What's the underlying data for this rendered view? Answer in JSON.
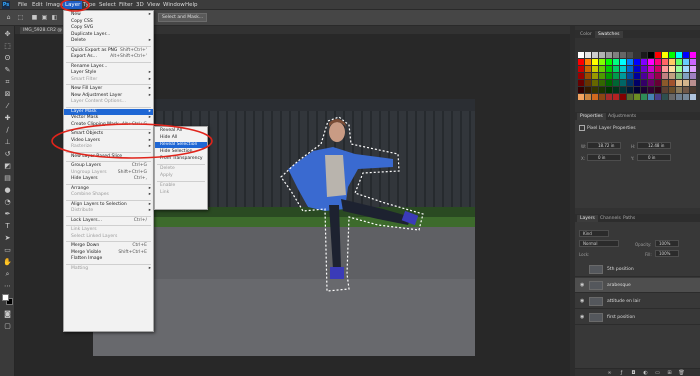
{
  "menubar": {
    "logo": "Ps",
    "items": [
      "File",
      "Edit",
      "Image",
      "Layer",
      "Type",
      "Select",
      "Filter",
      "3D",
      "View",
      "Window",
      "Help"
    ],
    "active": "Layer"
  },
  "options": {
    "select_and_mask": "Select and Mask..."
  },
  "document": {
    "tab_title": "IMG_5928.CR2 @ 16..."
  },
  "layer_menu": {
    "items": [
      {
        "label": "New",
        "arrow": "▸"
      },
      {
        "label": "Copy CSS"
      },
      {
        "label": "Copy SVG"
      },
      {
        "label": "Duplicate Layer..."
      },
      {
        "label": "Delete",
        "arrow": "▸"
      },
      {
        "sep": true
      },
      {
        "label": "Quick Export as PNG",
        "shortcut": "Shift+Ctrl+'"
      },
      {
        "label": "Export As...",
        "shortcut": "Alt+Shift+Ctrl+'"
      },
      {
        "sep": true
      },
      {
        "label": "Rename Layer..."
      },
      {
        "label": "Layer Style",
        "arrow": "▸"
      },
      {
        "label": "Smart Filter",
        "arrow": "▸",
        "disabled": true
      },
      {
        "sep": true
      },
      {
        "label": "New Fill Layer",
        "arrow": "▸"
      },
      {
        "label": "New Adjustment Layer",
        "arrow": "▸"
      },
      {
        "label": "Layer Content Options...",
        "disabled": true
      },
      {
        "sep": true
      },
      {
        "label": "Layer Mask",
        "arrow": "▸",
        "highlighted": true
      },
      {
        "label": "Vector Mask",
        "arrow": "▸"
      },
      {
        "label": "Create Clipping Mask",
        "shortcut": "Alt+Ctrl+G"
      },
      {
        "sep": true
      },
      {
        "label": "Smart Objects",
        "arrow": "▸"
      },
      {
        "label": "Video Layers",
        "arrow": "▸"
      },
      {
        "label": "Rasterize",
        "arrow": "▸",
        "disabled": true
      },
      {
        "sep": true
      },
      {
        "label": "New Layer Based Slice"
      },
      {
        "sep": true
      },
      {
        "label": "Group Layers",
        "shortcut": "Ctrl+G"
      },
      {
        "label": "Ungroup Layers",
        "shortcut": "Shift+Ctrl+G",
        "disabled": true
      },
      {
        "label": "Hide Layers",
        "shortcut": "Ctrl+,"
      },
      {
        "sep": true
      },
      {
        "label": "Arrange",
        "arrow": "▸"
      },
      {
        "label": "Combine Shapes",
        "arrow": "▸",
        "disabled": true
      },
      {
        "sep": true
      },
      {
        "label": "Align Layers to Selection",
        "arrow": "▸"
      },
      {
        "label": "Distribute",
        "arrow": "▸",
        "disabled": true
      },
      {
        "sep": true
      },
      {
        "label": "Lock Layers...",
        "shortcut": "Ctrl+/"
      },
      {
        "sep": true
      },
      {
        "label": "Link Layers",
        "disabled": true
      },
      {
        "label": "Select Linked Layers",
        "disabled": true
      },
      {
        "sep": true
      },
      {
        "label": "Merge Down",
        "shortcut": "Ctrl+E"
      },
      {
        "label": "Merge Visible",
        "shortcut": "Shift+Ctrl+E"
      },
      {
        "label": "Flatten Image"
      },
      {
        "sep": true
      },
      {
        "label": "Matting",
        "arrow": "▸",
        "disabled": true
      }
    ]
  },
  "layer_mask_submenu": {
    "items": [
      {
        "label": "Reveal All"
      },
      {
        "label": "Hide All"
      },
      {
        "label": "Reveal Selection",
        "highlighted": true
      },
      {
        "label": "Hide Selection"
      },
      {
        "label": "From Transparency"
      },
      {
        "sep": true
      },
      {
        "label": "Delete",
        "disabled": true
      },
      {
        "label": "Apply",
        "disabled": true
      },
      {
        "sep": true
      },
      {
        "label": "Enable",
        "disabled": true
      },
      {
        "label": "Link",
        "disabled": true
      }
    ]
  },
  "panels": {
    "color_tabs": [
      "Color",
      "Swatches"
    ],
    "properties_tabs": [
      "Properties",
      "Adjustments"
    ],
    "properties_title": "Pixel Layer Properties",
    "prop_w_label": "W:",
    "prop_w": "18.72 in",
    "prop_h_label": "H:",
    "prop_h": "12.48 in",
    "prop_x_label": "X:",
    "prop_x": "0 in",
    "prop_y_label": "Y:",
    "prop_y": "0 in",
    "layers_tabs": [
      "Layers",
      "Channels",
      "Paths"
    ],
    "kind_filter": "Kind",
    "blend_mode": "Normal",
    "opacity_label": "Opacity:",
    "opacity": "100%",
    "lock_label": "Lock:",
    "fill_label": "Fill:",
    "fill": "100%",
    "layers": [
      {
        "name": "5th position",
        "visible": false,
        "selected": false
      },
      {
        "name": "arabesque",
        "visible": true,
        "selected": true
      },
      {
        "name": "attitude en lair",
        "visible": true,
        "selected": false
      },
      {
        "name": "first position",
        "visible": true,
        "selected": false
      }
    ]
  },
  "swatch_colors": [
    [
      "#ffffff",
      "#e6e6e6",
      "#cccccc",
      "#b3b3b3",
      "#999999",
      "#808080",
      "#666666",
      "#4d4d4d",
      "#333333",
      "#1a1a1a",
      "#000000",
      "#ff0000",
      "#ffff00",
      "#00ff00",
      "#00ffff",
      "#0000ff",
      "#ff00ff"
    ],
    [
      "#ff0000",
      "#ff8000",
      "#ffff00",
      "#80ff00",
      "#00ff00",
      "#00ff80",
      "#00ffff",
      "#0080ff",
      "#0000ff",
      "#8000ff",
      "#ff00ff",
      "#ff0080",
      "#ff6666",
      "#ffcc66",
      "#66ff66",
      "#66ccff",
      "#cc66ff"
    ],
    [
      "#cc0000",
      "#cc6600",
      "#cccc00",
      "#66cc00",
      "#00cc00",
      "#00cc66",
      "#00cccc",
      "#0066cc",
      "#0000cc",
      "#6600cc",
      "#cc00cc",
      "#cc0066",
      "#ff9999",
      "#ffe0a0",
      "#99ff99",
      "#a0d8ff",
      "#e0a0ff"
    ],
    [
      "#990000",
      "#994c00",
      "#999900",
      "#4c9900",
      "#009900",
      "#00994c",
      "#009999",
      "#004c99",
      "#000099",
      "#4c0099",
      "#990099",
      "#99004c",
      "#c08080",
      "#c0a080",
      "#80c080",
      "#80a0c0",
      "#a080c0"
    ],
    [
      "#660000",
      "#663300",
      "#666600",
      "#336600",
      "#006600",
      "#006633",
      "#006666",
      "#003366",
      "#000066",
      "#330066",
      "#660066",
      "#660033",
      "#8b5a2b",
      "#a0522d",
      "#deb887",
      "#d2b48c",
      "#bc8f8f"
    ],
    [
      "#330000",
      "#331a00",
      "#333300",
      "#1a3300",
      "#003300",
      "#00331a",
      "#003333",
      "#001a33",
      "#000033",
      "#1a0033",
      "#330033",
      "#33001a",
      "#5c4033",
      "#6b4f2a",
      "#8a7a5a",
      "#705848",
      "#4a3a30"
    ],
    [
      "#f4a460",
      "#cd853f",
      "#d2691e",
      "#8b4513",
      "#a52a2a",
      "#b22222",
      "#800000",
      "#556b2f",
      "#6b8e23",
      "#2e8b57",
      "#4682b4",
      "#483d8b",
      "#2f4f4f",
      "#696969",
      "#708090",
      "#778899",
      "#b0c4de"
    ]
  ]
}
